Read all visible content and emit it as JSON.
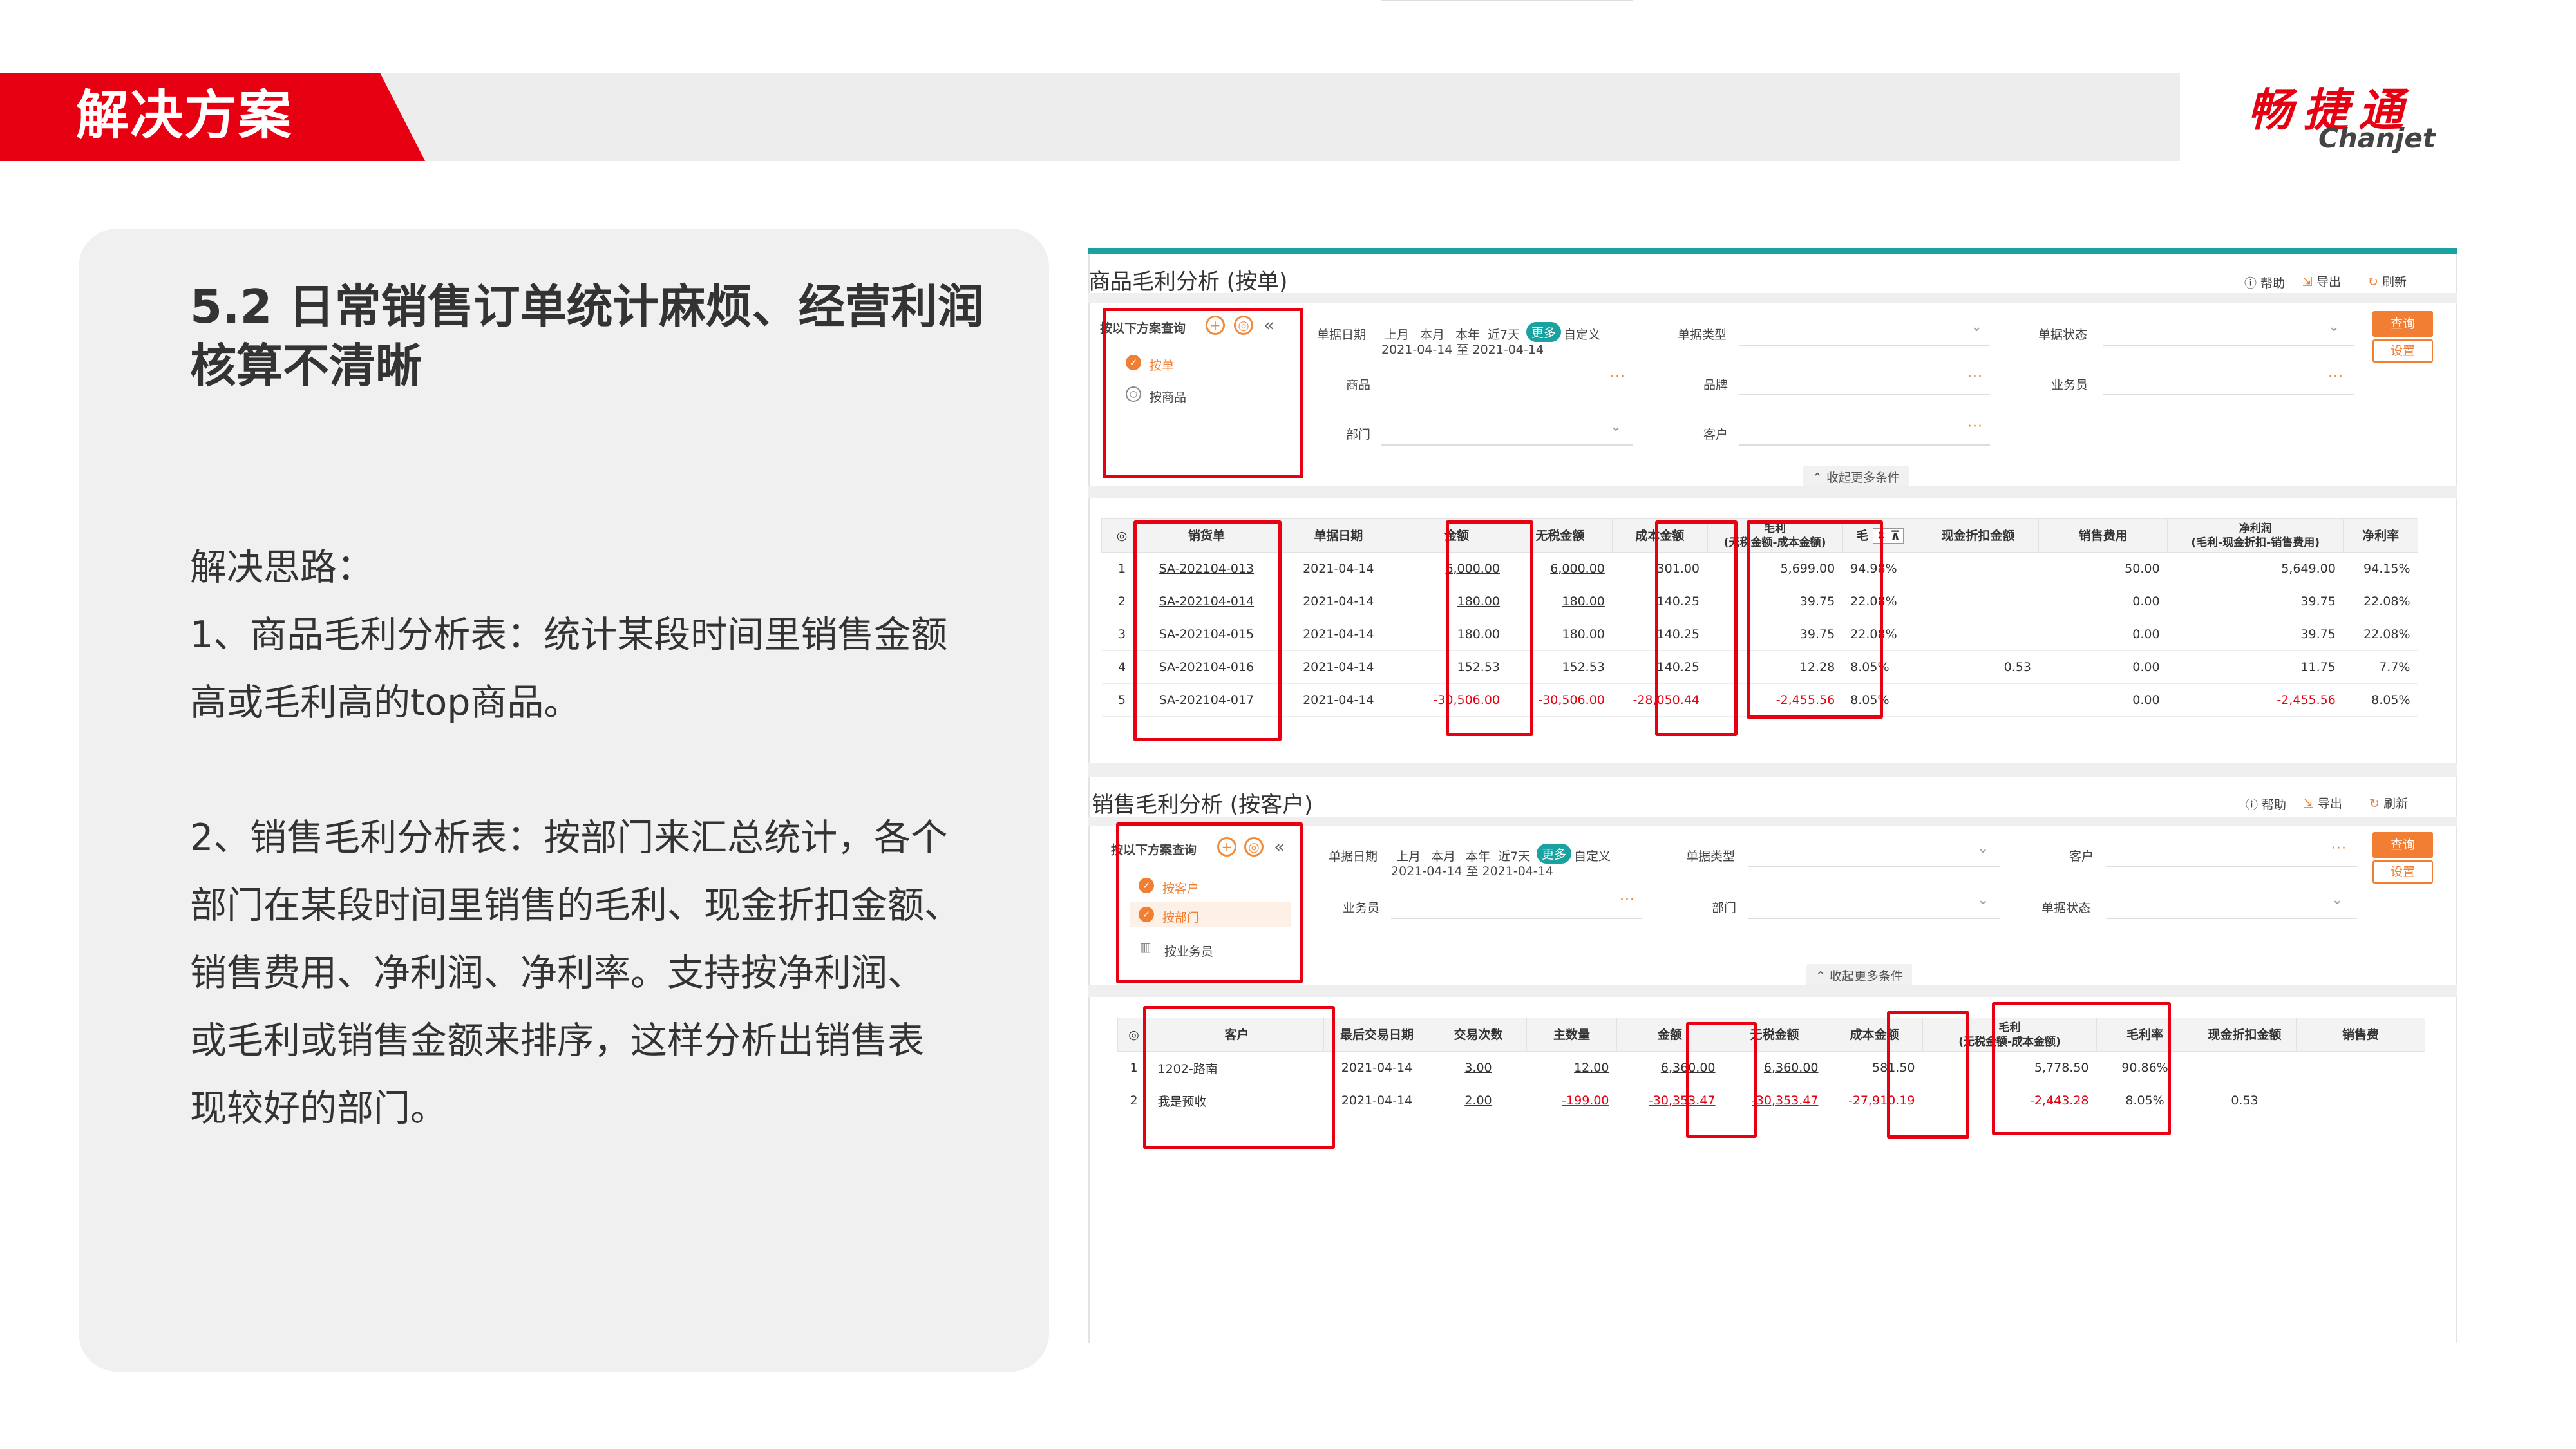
{
  "header": {
    "title": "解决方案",
    "logo_cn": "畅捷通",
    "logo_en": "Chanjet"
  },
  "left": {
    "title": "5.2 日常销售订单统计麻烦、经营利润核算不清晰",
    "lines": [
      "解决思路：",
      "1、商品毛利分析表：统计某段时间里销售金额",
      "高或毛利高的top商品。",
      "2、销售毛利分析表：按部门来汇总统计，各个",
      "部门在某段时间里销售的毛利、现金折扣金额、",
      "销售费用、净利润、净利率。支持按净利润、",
      "或毛利或销售金额来排序，这样分析出销售表",
      "现较好的部门。"
    ]
  },
  "toolbar": {
    "help": "帮助",
    "export": "导出",
    "refresh": "刷新"
  },
  "filters": {
    "date_label": "单据日期",
    "periods": [
      "上月",
      "本月",
      "本年",
      "近7天"
    ],
    "more": "更多",
    "custom": "自定义",
    "range": "2021-04-14 至 2021-04-14",
    "doc_type": "单据类型",
    "doc_status": "单据状态",
    "product": "商品",
    "brand": "品牌",
    "salesman": "业务员",
    "dept": "部门",
    "customer": "客户",
    "collapse": "收起更多条件",
    "query": "查询",
    "settings": "设置",
    "scheme_label": "按以下方案查询"
  },
  "w1": {
    "title": "商品毛利分析 (按单)",
    "options": [
      "按单",
      "按商品"
    ],
    "headers": [
      "销货单",
      "单据日期",
      "金额",
      "无税金额",
      "成本金额",
      "毛利\n(无税金额-成本金额)",
      "毛",
      "现金折扣金额",
      "销售费用",
      "净利润\n(毛利-现金折扣-销售费用)",
      "净利率"
    ],
    "rows": [
      {
        "no": "1",
        "doc": "SA-202104-013",
        "date": "2021-04-14",
        "amount": "6,000.00",
        "net": "6,000.00",
        "cost": "301.00",
        "gross": "5,699.00",
        "rate": "94.98%",
        "disc": "",
        "fee": "50.00",
        "profit": "5,649.00",
        "prate": "94.15%"
      },
      {
        "no": "2",
        "doc": "SA-202104-014",
        "date": "2021-04-14",
        "amount": "180.00",
        "net": "180.00",
        "cost": "140.25",
        "gross": "39.75",
        "rate": "22.08%",
        "disc": "",
        "fee": "0.00",
        "profit": "39.75",
        "prate": "22.08%"
      },
      {
        "no": "3",
        "doc": "SA-202104-015",
        "date": "2021-04-14",
        "amount": "180.00",
        "net": "180.00",
        "cost": "140.25",
        "gross": "39.75",
        "rate": "22.08%",
        "disc": "",
        "fee": "0.00",
        "profit": "39.75",
        "prate": "22.08%"
      },
      {
        "no": "4",
        "doc": "SA-202104-016",
        "date": "2021-04-14",
        "amount": "152.53",
        "net": "152.53",
        "cost": "140.25",
        "gross": "12.28",
        "rate": "8.05%",
        "disc": "0.53",
        "fee": "0.00",
        "profit": "11.75",
        "prate": "7.7%"
      },
      {
        "no": "5",
        "doc": "SA-202104-017",
        "date": "2021-04-14",
        "amount": "-30,506.00",
        "net": "-30,506.00",
        "cost": "-28,050.44",
        "gross": "-2,455.56",
        "rate": "8.05%",
        "disc": "",
        "fee": "0.00",
        "profit": "-2,455.56",
        "prate": "8.05%"
      }
    ]
  },
  "w2": {
    "title": "销售毛利分析 (按客户)",
    "options": [
      "按客户",
      "按部门",
      "按业务员"
    ],
    "headers": [
      "客户",
      "最后交易日期",
      "交易次数",
      "主数量",
      "金额",
      "无税金额",
      "成本金额",
      "毛利\n(无税金额-成本金额)",
      "毛利率",
      "现金折扣金额",
      "销售费"
    ],
    "rows": [
      {
        "no": "1",
        "cust": "1202-路南",
        "date": "2021-04-14",
        "times": "3.00",
        "qty": "12.00",
        "amount": "6,360.00",
        "net": "6,360.00",
        "cost": "581.50",
        "gross": "5,778.50",
        "rate": "90.86%",
        "disc": ""
      },
      {
        "no": "2",
        "cust": "我是预收",
        "date": "2021-04-14",
        "times": "2.00",
        "qty": "-199.00",
        "amount": "-30,353.47",
        "net": "-30,353.47",
        "cost": "-27,910.19",
        "gross": "-2,443.28",
        "rate": "8.05%",
        "disc": "0.53"
      }
    ]
  },
  "colors": {
    "brand_red": "#e60012",
    "teal": "#1aa2a0",
    "orange": "#f27e33"
  }
}
